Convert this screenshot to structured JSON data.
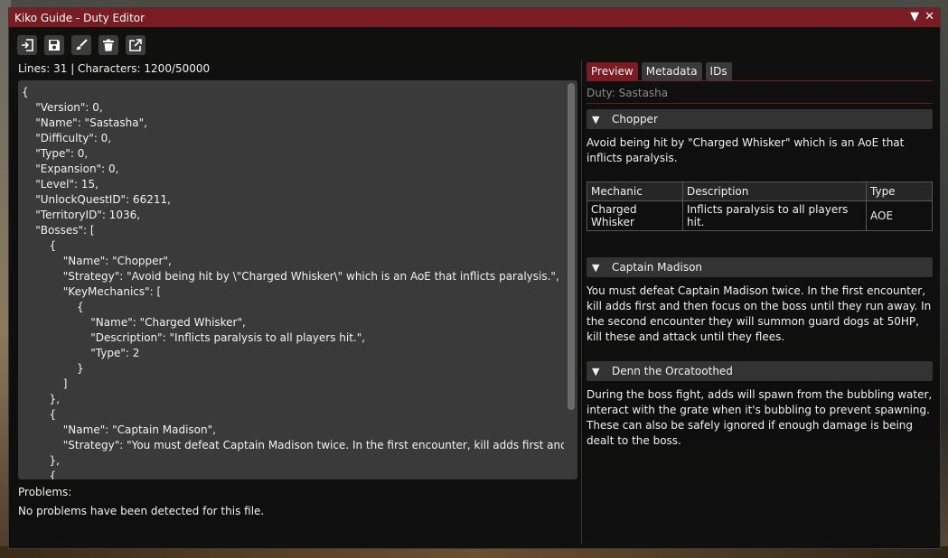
{
  "window": {
    "title": "Kiko Guide - Duty Editor"
  },
  "toolbar": {
    "buttons": [
      {
        "icon": "import-icon"
      },
      {
        "icon": "save-icon"
      },
      {
        "icon": "brush-icon"
      },
      {
        "icon": "trash-icon"
      },
      {
        "icon": "external-link-icon"
      }
    ]
  },
  "editor": {
    "stats": "Lines: 31 | Characters: 1200/50000",
    "content": "{\n    \"Version\": 0,\n    \"Name\": \"Sastasha\",\n    \"Difficulty\": 0,\n    \"Type\": 0,\n    \"Expansion\": 0,\n    \"Level\": 15,\n    \"UnlockQuestID\": 66211,\n    \"TerritoryID\": 1036,\n    \"Bosses\": [\n        {\n            \"Name\": \"Chopper\",\n            \"Strategy\": \"Avoid being hit by \\\"Charged Whisker\\\" which is an AoE that inflicts paralysis.\",\n            \"KeyMechanics\": [\n                {\n                    \"Name\": \"Charged Whisker\",\n                    \"Description\": \"Inflicts paralysis to all players hit.\",\n                    \"Type\": 2\n                }\n            ]\n        },\n        {\n            \"Name\": \"Captain Madison\",\n            \"Strategy\": \"You must defeat Captain Madison twice. In the first encounter, kill adds first and then fo\n        },\n        {"
  },
  "problems": {
    "label": "Problems:",
    "message": "No problems have been detected for this file."
  },
  "preview": {
    "tabs": [
      "Preview",
      "Metadata",
      "IDs"
    ],
    "duty_label": "Duty: Sastasha",
    "bosses": [
      {
        "name": "Chopper",
        "strategy": "Avoid being hit by \"Charged Whisker\" which is an AoE that inflicts paralysis.",
        "table": {
          "headers": [
            "Mechanic",
            "Description",
            "Type"
          ],
          "rows": [
            [
              "Charged Whisker",
              "Inflicts paralysis to all players hit.",
              "AOE"
            ]
          ]
        }
      },
      {
        "name": "Captain Madison",
        "strategy": "You must defeat Captain Madison twice. In the first encounter, kill adds first and then focus on the boss until they run away. In the second encounter they will summon guard dogs at 50HP, kill these and attack until they flees."
      },
      {
        "name": "Denn the Orcatoothed",
        "strategy": "During the boss fight, adds will spawn from the bubbling water, interact with the grate when it's bubbling to prevent spawning. These can also be safely ignored if enough damage is being dealt to the boss."
      }
    ]
  },
  "colors": {
    "titlebar": "#7a1c21",
    "active_tab": "#7a1c21",
    "panel_bg": "#0e0e0e"
  }
}
